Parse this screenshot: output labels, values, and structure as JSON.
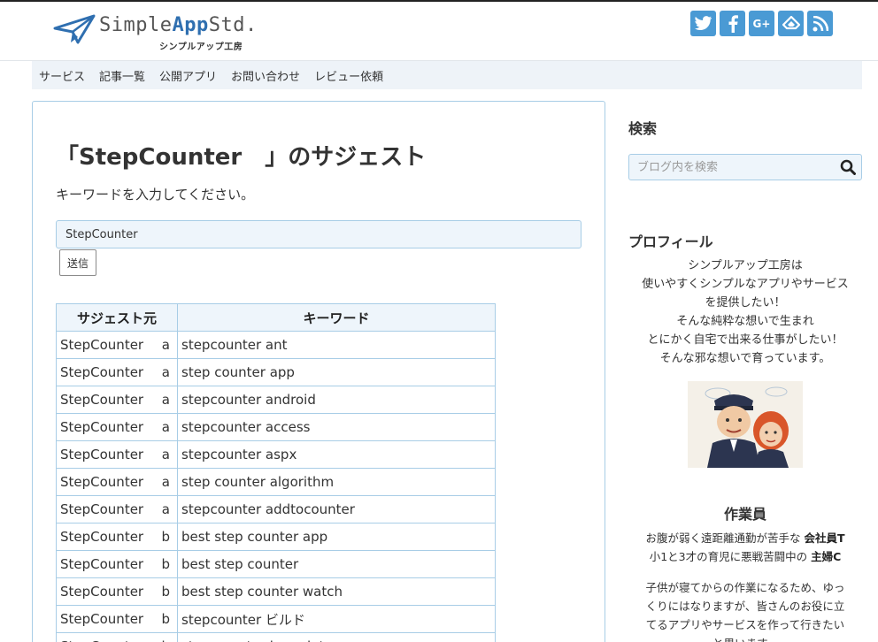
{
  "header": {
    "logo_prefix": "Simple",
    "logo_accent": "App",
    "logo_suffix": "Std.",
    "logo_sub": "シンプルアップ工房",
    "social": [
      {
        "icon": "twitter-icon",
        "glyph": "t"
      },
      {
        "icon": "facebook-icon",
        "glyph": "f"
      },
      {
        "icon": "google-plus-icon",
        "glyph": "G+"
      },
      {
        "icon": "feedly-icon",
        "glyph": "◈"
      },
      {
        "icon": "rss-icon",
        "glyph": "◔"
      }
    ]
  },
  "nav": [
    "サービス",
    "記事一覧",
    "公開アプリ",
    "お問い合わせ",
    "レビュー依頼"
  ],
  "main": {
    "title": "「StepCounter　」のサジェスト",
    "lead": "キーワードを入力してください。",
    "input_value": "StepCounter",
    "submit_label": "送信",
    "table": {
      "headers": [
        "サジェスト元",
        "キーワード"
      ],
      "rows": [
        {
          "src": "StepCounter",
          "letter": "a",
          "keyword": "stepcounter ant"
        },
        {
          "src": "StepCounter",
          "letter": "a",
          "keyword": "step counter app"
        },
        {
          "src": "StepCounter",
          "letter": "a",
          "keyword": "stepcounter android"
        },
        {
          "src": "StepCounter",
          "letter": "a",
          "keyword": "stepcounter access"
        },
        {
          "src": "StepCounter",
          "letter": "a",
          "keyword": "stepcounter aspx"
        },
        {
          "src": "StepCounter",
          "letter": "a",
          "keyword": "step counter algorithm"
        },
        {
          "src": "StepCounter",
          "letter": "a",
          "keyword": "stepcounter addtocounter"
        },
        {
          "src": "StepCounter",
          "letter": "b",
          "keyword": "best step counter app"
        },
        {
          "src": "StepCounter",
          "letter": "b",
          "keyword": "best step counter"
        },
        {
          "src": "StepCounter",
          "letter": "b",
          "keyword": "best step counter watch"
        },
        {
          "src": "StepCounter",
          "letter": "b",
          "keyword": "stepcounter ビルド"
        },
        {
          "src": "StepCounter",
          "letter": "b",
          "keyword": "step counter bracelet"
        }
      ]
    }
  },
  "sidebar": {
    "search_title": "検索",
    "search_placeholder": "ブログ内を検索",
    "profile_title": "プロフィール",
    "profile_lines": [
      "シンプルアップ工房は",
      "使いやすくシンプルなアプリやサービス",
      "を提供したい！",
      "そんな純粋な想いで生まれ",
      "とにかく自宅で出来る仕事がしたい！",
      "そんな邪な想いで育っています。"
    ],
    "worker_title": "作業員",
    "worker_line1_pre": "お腹が弱く遠距離通勤が苦手な ",
    "worker_line1_b": "会社員T",
    "worker_line2_pre": "小1と3才の育児に悪戦苦闘中の ",
    "worker_line2_b": "主婦C",
    "worker_para": [
      "子供が寝てからの作業になるため、ゆっ",
      "くりにはなりますが、皆さんのお役に立",
      "てるアプリやサービスを作って行きたい",
      "と思います。"
    ]
  }
}
